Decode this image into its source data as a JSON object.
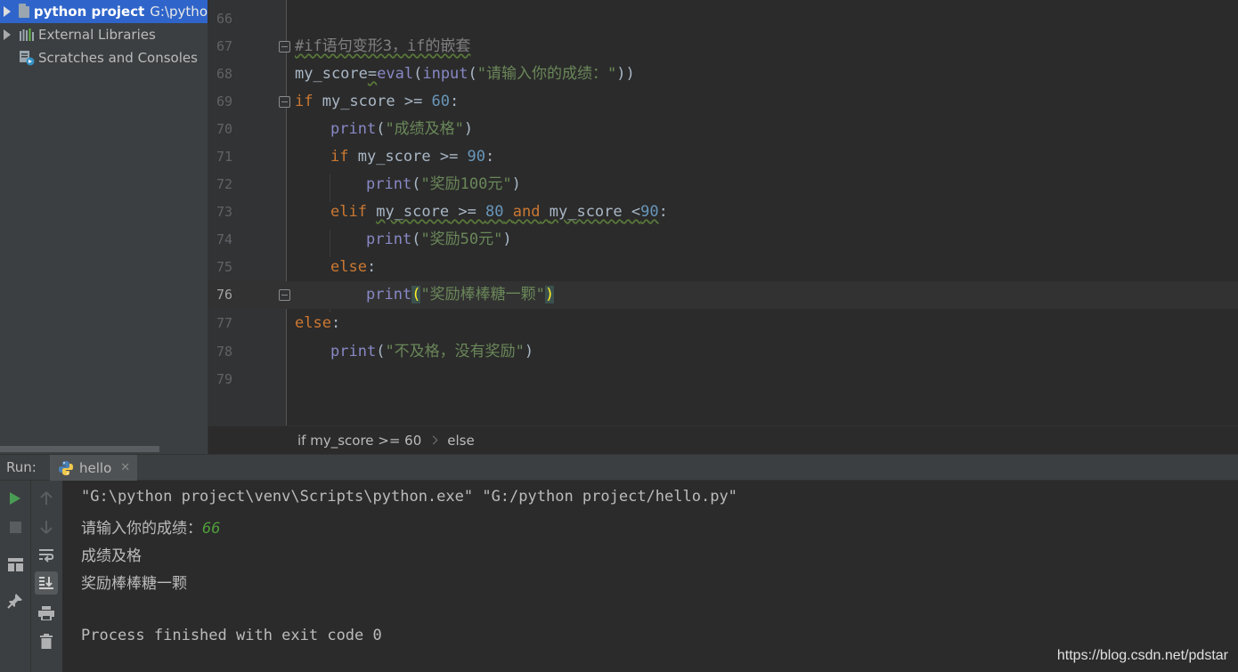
{
  "project_tree": {
    "items": [
      {
        "name": "python project",
        "path": "G:\\pytho",
        "selected": true
      },
      {
        "name": "External Libraries"
      },
      {
        "name": "Scratches and Consoles"
      }
    ]
  },
  "editor": {
    "lines": [
      {
        "num": "66"
      },
      {
        "num": "67"
      },
      {
        "num": "68"
      },
      {
        "num": "69"
      },
      {
        "num": "70"
      },
      {
        "num": "71"
      },
      {
        "num": "72"
      },
      {
        "num": "73"
      },
      {
        "num": "74"
      },
      {
        "num": "75"
      },
      {
        "num": "76"
      },
      {
        "num": "77"
      },
      {
        "num": "78"
      },
      {
        "num": "79"
      }
    ],
    "code": {
      "l67_comment": "#if语句变形3，if的嵌套",
      "l68_var": "my_score",
      "l68_eq": "=",
      "l68_eval": "eval",
      "l68_p1": "(",
      "l68_input": "input",
      "l68_p2": "(",
      "l68_str": "\"请输入你的成绩：\"",
      "l68_p3": "))",
      "l69_if": "if",
      "l69_mid": " my_score >= ",
      "l69_num": "60",
      "l69_colon": ":",
      "l70_print": "print",
      "l70_p1": "(",
      "l70_str": "\"成绩及格\"",
      "l70_p2": ")",
      "l71_if": "if",
      "l71_mid": " my_score >= ",
      "l71_num": "90",
      "l71_colon": ":",
      "l72_print": "print",
      "l72_p1": "(",
      "l72_str": "\"奖励100元\"",
      "l72_p2": ")",
      "l73_elif": "elif",
      "l73_sp": " ",
      "l73_var1": "my_score",
      "l73_op1": " >= ",
      "l73_num1": "80",
      "l73_sp2": " ",
      "l73_and": "and",
      "l73_sp3": " ",
      "l73_var2": "my_score",
      "l73_op2": " <",
      "l73_num2": "90",
      "l73_colon": ":",
      "l74_print": "print",
      "l74_p1": "(",
      "l74_str": "\"奖励50元\"",
      "l74_p2": ")",
      "l75_else": "else",
      "l75_colon": ":",
      "l76_print": "print",
      "l76_p1": "(",
      "l76_str": "\"奖励棒棒糖一颗\"",
      "l76_p2": ")",
      "l77_else": "else",
      "l77_colon": ":",
      "l78_print": "print",
      "l78_p1": "(",
      "l78_str": "\"不及格，没有奖励\"",
      "l78_p2": ")"
    },
    "current_line": "76"
  },
  "breadcrumb": {
    "items": [
      "if my_score >= 60",
      "else"
    ]
  },
  "run": {
    "label": "Run:",
    "tab_name": "hello",
    "close_glyph": "✕"
  },
  "console": {
    "command": "\"G:\\python project\\venv\\Scripts\\python.exe\" \"G:/python project/hello.py\"",
    "prompt": "请输入你的成绩：",
    "input_value": "66",
    "out1": "成绩及格",
    "out2": "奖励棒棒糖一颗",
    "finish": "Process finished with exit code 0"
  },
  "watermark": "https://blog.csdn.net/pdstar",
  "colors": {
    "keyword": "#cc7832",
    "builtin": "#8888c6",
    "string": "#6a8759",
    "number": "#6897bb",
    "comment": "#808080",
    "selection": "#2f65ca",
    "run_green": "#499c54"
  }
}
